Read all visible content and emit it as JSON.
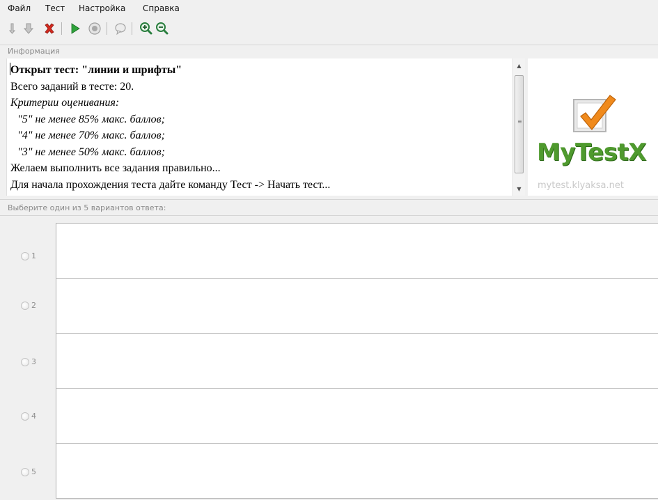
{
  "menu": {
    "items": [
      "Файл",
      "Тест",
      "Настройка",
      "Справка"
    ]
  },
  "toolbar": {
    "buttons": [
      {
        "icon": "open-icon"
      },
      {
        "icon": "download-icon"
      },
      {
        "icon": "close-test-icon",
        "color": "#d32a1f"
      },
      {
        "icon": "play-icon",
        "color": "#2fa33b"
      },
      {
        "icon": "stop-icon"
      },
      {
        "icon": "comment-icon"
      },
      {
        "icon": "zoom-in-icon",
        "color": "#2a7f3f"
      },
      {
        "icon": "zoom-out-icon",
        "color": "#2a7f3f"
      }
    ]
  },
  "info": {
    "section_label": "Информация",
    "lines": [
      "Открыт тест: \"линии и шрифты\"",
      "Всего заданий в тесте: 20.",
      "Критерии оценивания:",
      "\"5\" не менее 85% макс. баллов;",
      "\"4\" не менее 70% макс. баллов;",
      "\"3\" не менее 50% макс. баллов;",
      "Желаем выполнить все задания правильно...",
      "Для начала прохождения теста дайте команду Тест -> Начать тест..."
    ]
  },
  "logo": {
    "text": "MyTestX",
    "url": "mytest.klyaksa.net",
    "brand_color": "#4f9a2e",
    "check_color": "#f08a1c"
  },
  "answers": {
    "section_label": "Выберите один из 5 вариантов ответа:",
    "options": [
      "1",
      "2",
      "3",
      "4",
      "5"
    ]
  }
}
